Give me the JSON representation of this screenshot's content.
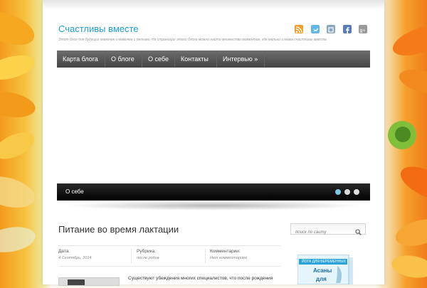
{
  "site": {
    "title": "Счастливы вместе",
    "description": "Этот блог для будущих мамочек и мамочек с детьми. На страницах этого блога можно найти множество моментов, где малыш и мама счастливы вместе"
  },
  "social": [
    {
      "icon": "rss-icon",
      "color": "#f0a030"
    },
    {
      "icon": "twitter-icon",
      "color": "#5fb8e6"
    },
    {
      "icon": "square-icon",
      "color": "#8aa6c1"
    },
    {
      "icon": "facebook-icon",
      "color": "#5b7bb5"
    },
    {
      "icon": "google-plus-icon",
      "color": "#9a9a9a"
    }
  ],
  "nav": {
    "items": [
      {
        "label": "Карта блога"
      },
      {
        "label": "О блоге"
      },
      {
        "label": "О себе"
      },
      {
        "label": "Контакты"
      },
      {
        "label": "Интервью »"
      }
    ]
  },
  "slider": {
    "caption": "О себе",
    "dots": 3,
    "active_dot": 1
  },
  "post": {
    "title": "Питание во время лактации",
    "meta": [
      {
        "label": "Дата:",
        "value": "4 Сентябрь, 2014"
      },
      {
        "label": "Рубрика:",
        "value": "после родов"
      },
      {
        "label": "Комментарии:",
        "value": "Нет комментариев"
      }
    ],
    "excerpt": "Существуют убеждения многих специалистов, что после рождения"
  },
  "sidebar": {
    "search_placeholder": "поиск по сайту",
    "book_text_1": "ЙОГА ДЛЯ БЕРЕМЕННЫХ",
    "book_text_2": "Асаны",
    "book_text_3": "для"
  },
  "colors": {
    "accent": "#1e9fd2",
    "nav_bg": "#555555",
    "caption_bg": "#111111"
  }
}
